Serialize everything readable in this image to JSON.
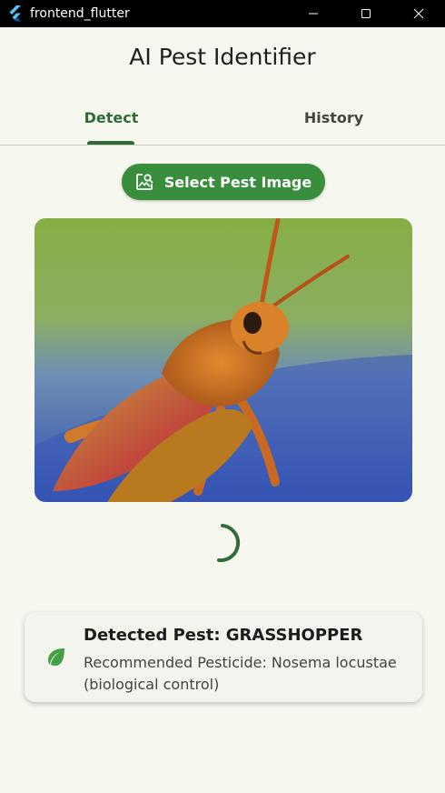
{
  "window": {
    "title": "frontend_flutter"
  },
  "header": {
    "title": "AI Pest Identifier"
  },
  "tabs": [
    {
      "label": "Detect",
      "selected": true
    },
    {
      "label": "History",
      "selected": false
    }
  ],
  "actions": {
    "select_image_label": "Select Pest Image"
  },
  "image": {
    "subject": "grasshopper"
  },
  "result": {
    "pest": "Detected Pest: GRASSHOPPER",
    "pesticide": "Recommended Pesticide: Nosema locustae (biological control)"
  },
  "icons": {
    "title_logo": "flutter-logo-icon",
    "select": "image-search-icon",
    "result": "leaf-icon"
  },
  "colors": {
    "primary": "#388e3c",
    "tab_accent": "#2e6b34",
    "background": "#f6f8ef",
    "card": "#f3f4ee",
    "leaf": "#43a047"
  }
}
